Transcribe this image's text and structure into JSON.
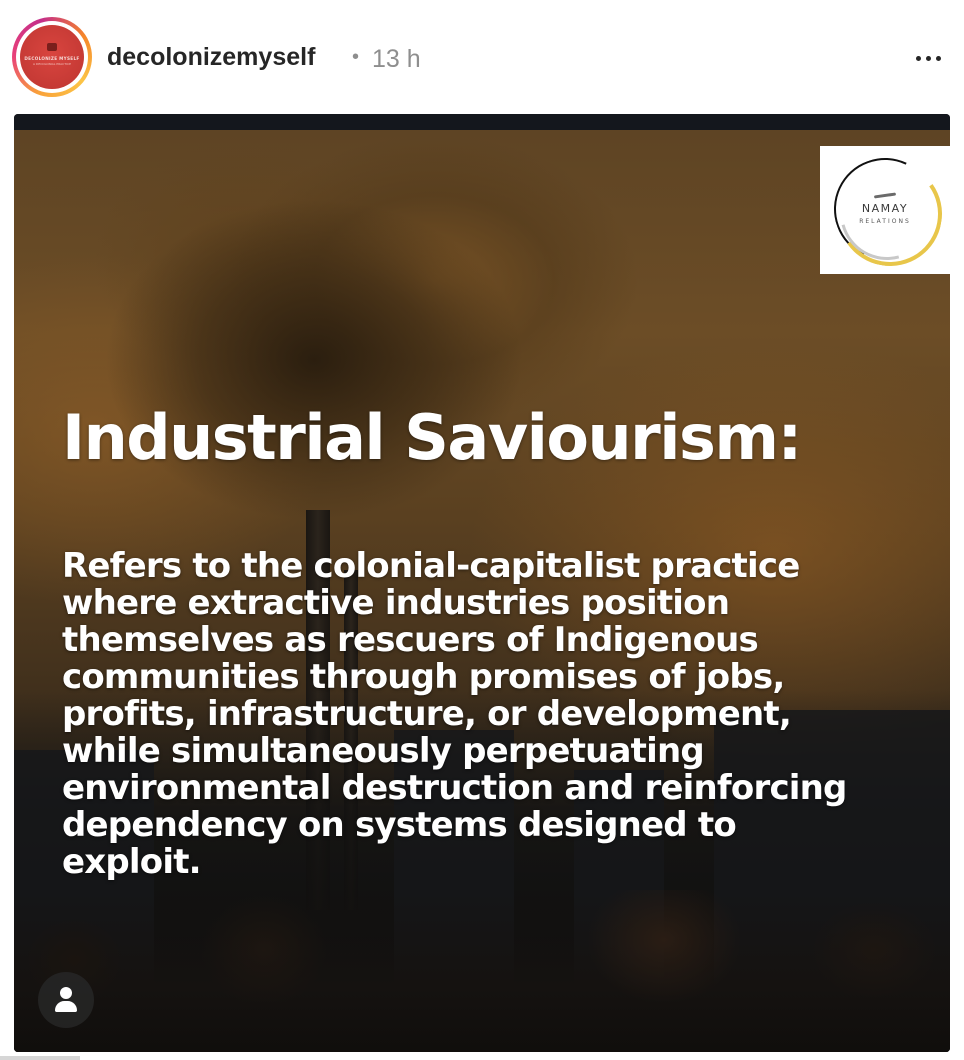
{
  "post": {
    "username": "decolonizemyself",
    "separator": "•",
    "time": "13 h",
    "avatar": {
      "text": "DECOLONIZE MYSELF",
      "subtext": "A DECOLONIAL PRACTICE",
      "color": "#c63a35"
    },
    "more_icon": "more-horizontal-icon"
  },
  "media": {
    "logo": {
      "title": "NAMAY",
      "subtitle": "RELATIONS",
      "accent": "#e8c64a"
    },
    "headline": "Industrial Saviourism:",
    "definition_lines": [
      "Refers to the colonial-capitalist practice",
      "where extractive industries position",
      "themselves as rescuers of Indigenous",
      "communities through promises of jobs,",
      "profits, infrastructure, or development,",
      "while simultaneously perpetuating",
      "environmental destruction and reinforcing",
      "dependency on systems designed to",
      "exploit."
    ],
    "tags_icon": "user-tag-icon"
  }
}
